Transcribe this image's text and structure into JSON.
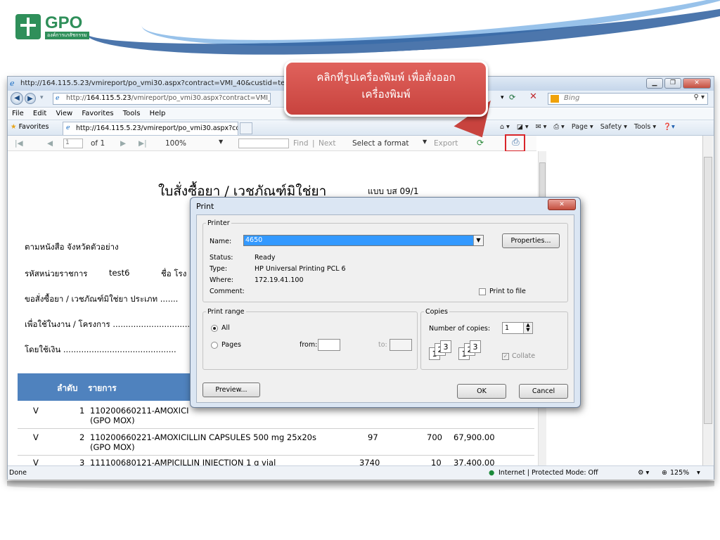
{
  "slide": {
    "logo_text": "GPO",
    "logo_sub": "องค์การเภสัชกรรม"
  },
  "browser": {
    "title": "http://164.115.5.23/vmireport/po_vmi30.aspx?contract=VMI_40&custid=test6&gendate=2",
    "url_prefix": "http://",
    "url_host": "164.115.5.23",
    "url_rest": "/vmireport/po_vmi30.aspx?contract=VMI_40&custid=tes",
    "search_placeholder": "Bing",
    "menu": [
      "File",
      "Edit",
      "View",
      "Favorites",
      "Tools",
      "Help"
    ],
    "favorites_label": "Favorites",
    "tab_label": "http://164.115.5.23/vmireport/po_vmi30.aspx?co...",
    "cmd": [
      "Page ▾",
      "Safety ▾",
      "Tools ▾"
    ],
    "status_left": "Done",
    "status_zone": "Internet | Protected Mode: Off",
    "zoom": "125%"
  },
  "report_toolbar": {
    "page": "1",
    "of": "of 1",
    "zoom": "100%",
    "find": "Find",
    "next": "Next",
    "format": "Select a format",
    "export": "Export"
  },
  "report": {
    "title": "ใบสั่งซื้อยา / เวชภัณฑ์มิใช่ยา",
    "form_no": "แบบ บส 09/1",
    "line1": "ตามหนังสือ จังหวัดตัวอย่าง",
    "line2_label": "รหัสหน่วยราชการ",
    "line2_value": "test6",
    "line2_name": "ชื่อ โรง",
    "line3": "ขอสั่งซื้อยา / เวชภัณฑ์มิใช่ยา ประเภท .......",
    "line4": "เพื่อใช้ในงาน / โครงการ ..............................",
    "line5": "โดยใช้เงิน ............................................",
    "col_no": "ลำดับ",
    "col_item": "รายการ",
    "rows": [
      {
        "flag": "V",
        "no": "1",
        "item": "110200660211-AMOXICI",
        "item2": "(GPO MOX)",
        "qty": "",
        "price": "",
        "total": ""
      },
      {
        "flag": "V",
        "no": "2",
        "item": "110200660221-AMOXICILLIN CAPSULES 500 mg 25x20s",
        "item2": "(GPO MOX)",
        "qty": "97",
        "price": "700",
        "total": "67,900.00"
      },
      {
        "flag": "V",
        "no": "3",
        "item": "111100680121-AMPICILLIN INJECTION 1 g vial",
        "item2": "",
        "qty": "3740",
        "price": "10",
        "total": "37,400.00"
      }
    ]
  },
  "callout": {
    "text1": "คลิกที่รูปเครื่องพิมพ์ เพื่อสั่งออก",
    "text2": "เครื่องพิมพ์"
  },
  "print_dialog": {
    "title": "Print",
    "printer_legend": "Printer",
    "name_label": "Name:",
    "name_value": "4650",
    "properties": "Properties...",
    "status_label": "Status:",
    "status_value": "Ready",
    "type_label": "Type:",
    "type_value": "HP Universal Printing PCL 6",
    "where_label": "Where:",
    "where_value": "172.19.41.100",
    "comment_label": "Comment:",
    "print_to_file": "Print to file",
    "range_legend": "Print range",
    "all": "All",
    "pages": "Pages",
    "from": "from:",
    "to": "to:",
    "copies_legend": "Copies",
    "num_copies": "Number of copies:",
    "copies_value": "1",
    "collate": "Collate",
    "preview": "Preview...",
    "ok": "OK",
    "cancel": "Cancel"
  }
}
